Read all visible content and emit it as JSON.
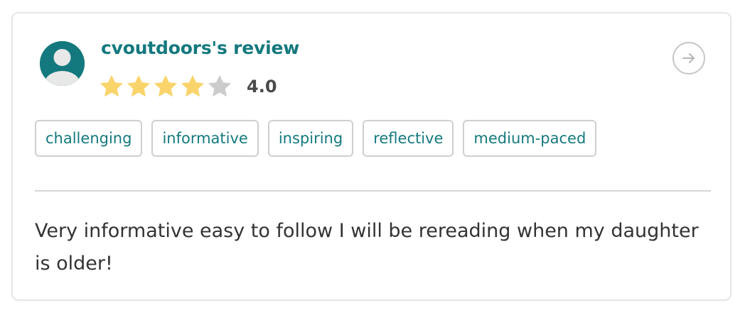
{
  "review": {
    "title": "cvoutdoors's review",
    "rating": 4,
    "rating_max": 5,
    "rating_text": "4.0",
    "tags": [
      "challenging",
      "informative",
      "inspiring",
      "reflective",
      "medium-paced"
    ],
    "text": "Very informative easy to follow I will be rereading when my daughter is older!"
  },
  "icons": {
    "avatar": "default-user-avatar-icon",
    "arrow": "arrow-right-icon",
    "star": "star-icon"
  },
  "colors": {
    "accent": "#14797e",
    "star_filled": "#f9d46b",
    "star_empty": "#cccccc",
    "border": "#e6e6e6"
  }
}
